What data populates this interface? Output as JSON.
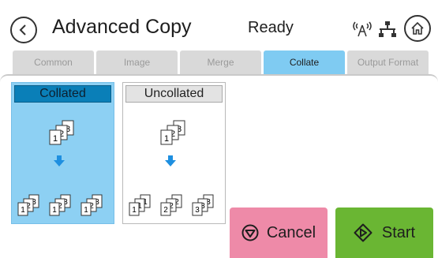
{
  "header": {
    "title": "Advanced Copy",
    "status": "Ready",
    "back_icon": "chevron-left-icon",
    "wifi_icon": "wireless-icon",
    "network_icon": "network-icon",
    "home_icon": "home-icon"
  },
  "tabs": [
    {
      "label": "Common",
      "active": false
    },
    {
      "label": "Image",
      "active": false
    },
    {
      "label": "Merge",
      "active": false
    },
    {
      "label": "Collate",
      "active": true
    },
    {
      "label": "Output Format",
      "active": false
    }
  ],
  "options": {
    "collated": {
      "label": "Collated",
      "selected": true
    },
    "uncollated": {
      "label": "Uncollated",
      "selected": false
    }
  },
  "actions": {
    "cancel_label": "Cancel",
    "start_label": "Start"
  },
  "colors": {
    "active_tab": "#7fcbf2",
    "selected_option": "#8dd0f3",
    "cancel": "#ee8aa8",
    "start": "#6ab633",
    "arrow": "#1e8fe0"
  }
}
